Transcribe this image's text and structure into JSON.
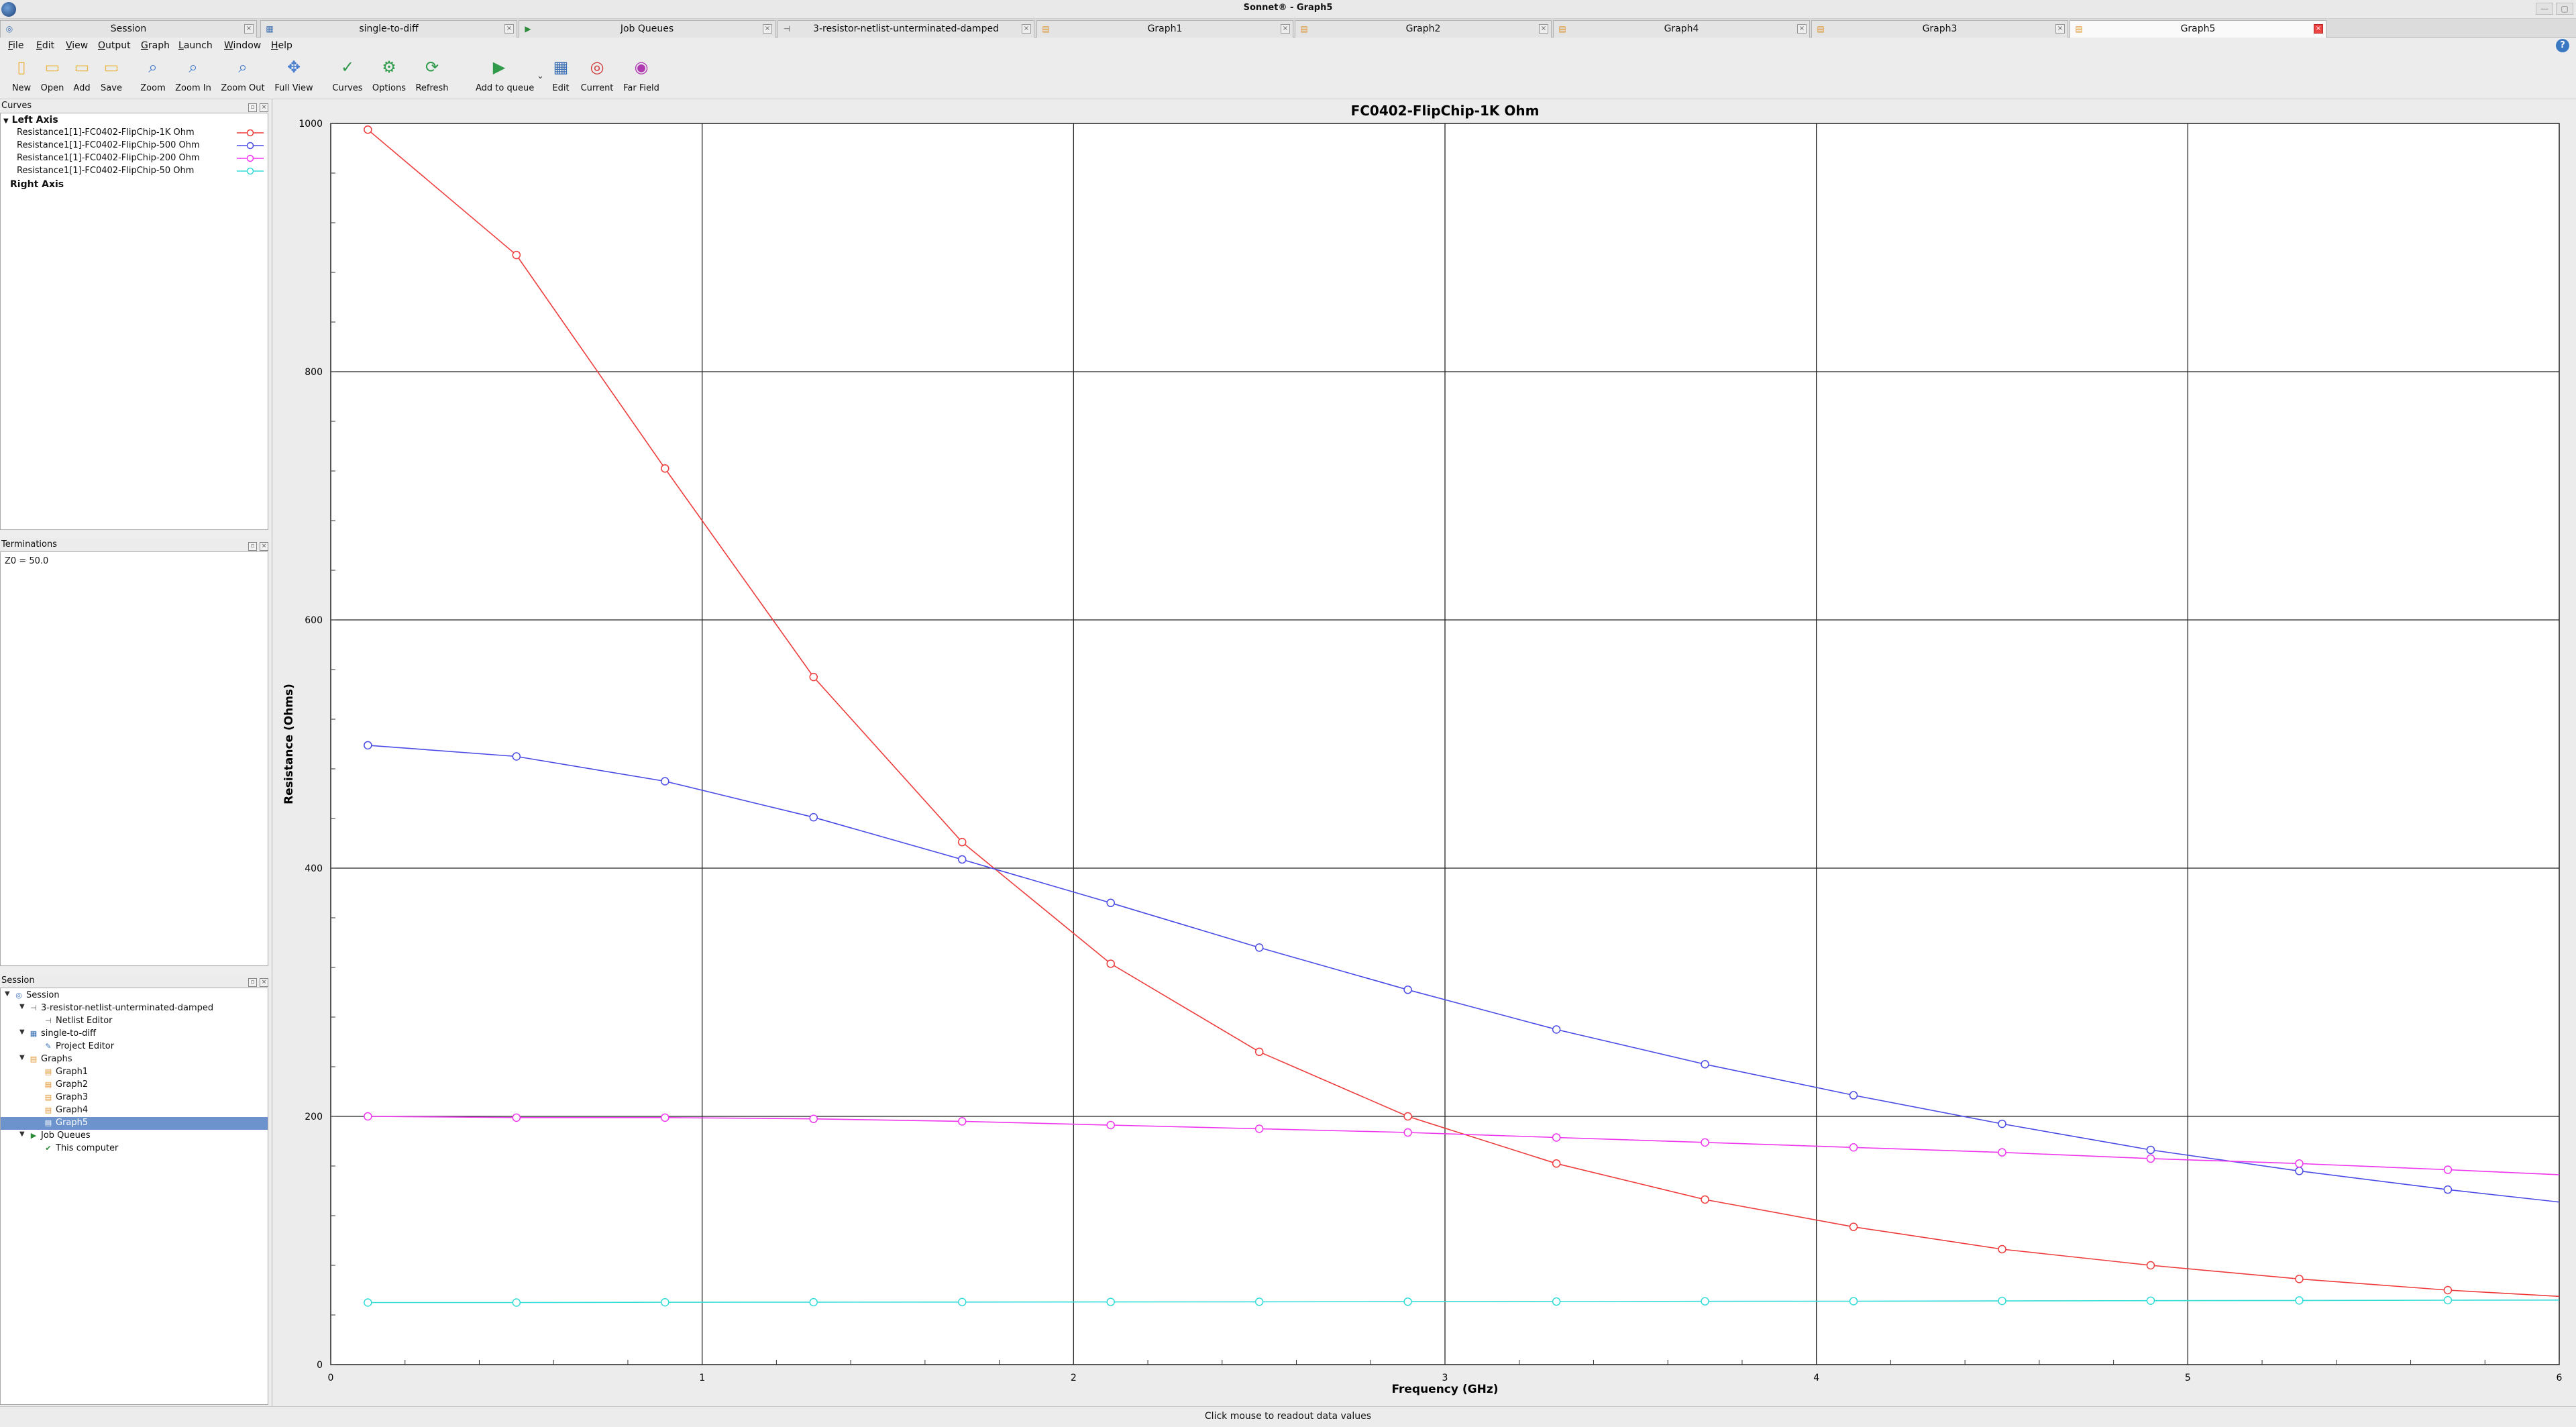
{
  "window": {
    "title": "Sonnet® - Graph5"
  },
  "tabs": [
    {
      "label": "Session",
      "icon": "session-icon"
    },
    {
      "label": "single-to-diff",
      "icon": "project-icon"
    },
    {
      "label": "Job Queues",
      "icon": "job-queue-icon"
    },
    {
      "label": "3-resistor-netlist-unterminated-damped",
      "icon": "netlist-icon"
    },
    {
      "label": "Graph1",
      "icon": "graph-icon"
    },
    {
      "label": "Graph2",
      "icon": "graph-icon"
    },
    {
      "label": "Graph4",
      "icon": "graph-icon"
    },
    {
      "label": "Graph3",
      "icon": "graph-icon"
    },
    {
      "label": "Graph5",
      "icon": "graph-icon",
      "active": true
    }
  ],
  "menu": [
    "File",
    "Edit",
    "View",
    "Output",
    "Graph",
    "Launch",
    "Window",
    "Help"
  ],
  "toolbar": [
    {
      "label": "New",
      "icon": "new-file-icon"
    },
    {
      "label": "Open",
      "icon": "open-folder-icon"
    },
    {
      "label": "Add",
      "icon": "add-folder-icon"
    },
    {
      "label": "Save",
      "icon": "save-icon"
    },
    {
      "label": "Zoom",
      "icon": "zoom-icon"
    },
    {
      "label": "Zoom In",
      "icon": "zoom-in-icon"
    },
    {
      "label": "Zoom Out",
      "icon": "zoom-out-icon"
    },
    {
      "label": "Full View",
      "icon": "full-view-icon"
    },
    {
      "label": "Curves",
      "icon": "curves-icon"
    },
    {
      "label": "Options",
      "icon": "options-gear-icon"
    },
    {
      "label": "Refresh",
      "icon": "refresh-icon"
    },
    {
      "label": "Add to queue",
      "icon": "add-to-queue-icon"
    },
    {
      "label": "Edit",
      "icon": "edit-icon"
    },
    {
      "label": "Current",
      "icon": "current-icon"
    },
    {
      "label": "Far Field",
      "icon": "far-field-icon"
    }
  ],
  "curves_panel": {
    "title": "Curves",
    "left_axis_label": "Left Axis",
    "right_axis_label": "Right Axis",
    "curves": [
      {
        "label": "Resistance1[1]-FC0402-FlipChip-1K Ohm",
        "color": "#ee3b3b"
      },
      {
        "label": "Resistance1[1]-FC0402-FlipChip-500 Ohm",
        "color": "#4b4be6"
      },
      {
        "label": "Resistance1[1]-FC0402-FlipChip-200 Ohm",
        "color": "#ee36ee"
      },
      {
        "label": "Resistance1[1]-FC0402-FlipChip-50 Ohm",
        "color": "#33dcd8"
      }
    ]
  },
  "terminations_panel": {
    "title": "Terminations",
    "text": "Z0 = 50.0"
  },
  "session_panel": {
    "title": "Session",
    "tree": [
      {
        "label": "Session",
        "icon": "session-icon",
        "level": 0,
        "expanded": true
      },
      {
        "label": "3-resistor-netlist-unterminated-damped",
        "icon": "netlist-icon",
        "level": 1,
        "expanded": true
      },
      {
        "label": "Netlist Editor",
        "icon": "netlist-editor-icon",
        "level": 2
      },
      {
        "label": "single-to-diff",
        "icon": "project-icon",
        "level": 1,
        "expanded": true
      },
      {
        "label": "Project Editor",
        "icon": "project-editor-icon",
        "level": 2
      },
      {
        "label": "Graphs",
        "icon": "graphs-folder-icon",
        "level": 1,
        "expanded": true
      },
      {
        "label": "Graph1",
        "icon": "graph-icon",
        "level": 2
      },
      {
        "label": "Graph2",
        "icon": "graph-icon",
        "level": 2
      },
      {
        "label": "Graph3",
        "icon": "graph-icon",
        "level": 2
      },
      {
        "label": "Graph4",
        "icon": "graph-icon",
        "level": 2
      },
      {
        "label": "Graph5",
        "icon": "graph-icon",
        "level": 2,
        "selected": true
      },
      {
        "label": "Job Queues",
        "icon": "job-queue-icon",
        "level": 1,
        "expanded": true
      },
      {
        "label": "This computer",
        "icon": "computer-check-icon",
        "level": 2
      }
    ]
  },
  "status_text": "Click mouse to readout data values",
  "chart_data": {
    "type": "line",
    "title": "FC0402-FlipChip-1K Ohm",
    "xlabel": "Frequency (GHz)",
    "ylabel": "Resistance (Ohms)",
    "xlim": [
      0,
      6
    ],
    "ylim": [
      0,
      1000
    ],
    "xticks": [
      0,
      1,
      2,
      3,
      4,
      5,
      6
    ],
    "yticks": [
      0,
      200,
      400,
      600,
      800,
      1000
    ],
    "grid": true,
    "x": [
      0.1,
      0.5,
      0.9,
      1.3,
      1.7,
      2.1,
      2.5,
      2.9,
      3.3,
      3.7,
      4.1,
      4.5,
      4.9,
      5.3,
      5.7,
      6.0
    ],
    "series": [
      {
        "name": "Resistance1[1]-FC0402-FlipChip-1K Ohm",
        "color": "#ee3b3b",
        "values": [
          995,
          894,
          722,
          554,
          421,
          323,
          252,
          200,
          162,
          133,
          111,
          93,
          80,
          69,
          60,
          55
        ],
        "markers": 15
      },
      {
        "name": "Resistance1[1]-FC0402-FlipChip-500 Ohm",
        "color": "#4b4be6",
        "values": [
          499,
          490,
          470,
          441,
          407,
          372,
          336,
          302,
          270,
          242,
          217,
          194,
          173,
          156,
          141,
          131
        ],
        "markers": 15
      },
      {
        "name": "Resistance1[1]-FC0402-FlipChip-200 Ohm",
        "color": "#ee36ee",
        "values": [
          200,
          199,
          199,
          198,
          196,
          193,
          190,
          187,
          183,
          179,
          175,
          171,
          166,
          162,
          157,
          153
        ],
        "markers": 15
      },
      {
        "name": "Resistance1[1]-FC0402-FlipChip-50 Ohm",
        "color": "#33dcd8",
        "values": [
          50,
          50,
          50.2,
          50.3,
          50.4,
          50.5,
          50.6,
          50.7,
          50.8,
          51,
          51.1,
          51.3,
          51.5,
          51.7,
          51.9,
          52
        ],
        "markers": 15
      }
    ]
  }
}
